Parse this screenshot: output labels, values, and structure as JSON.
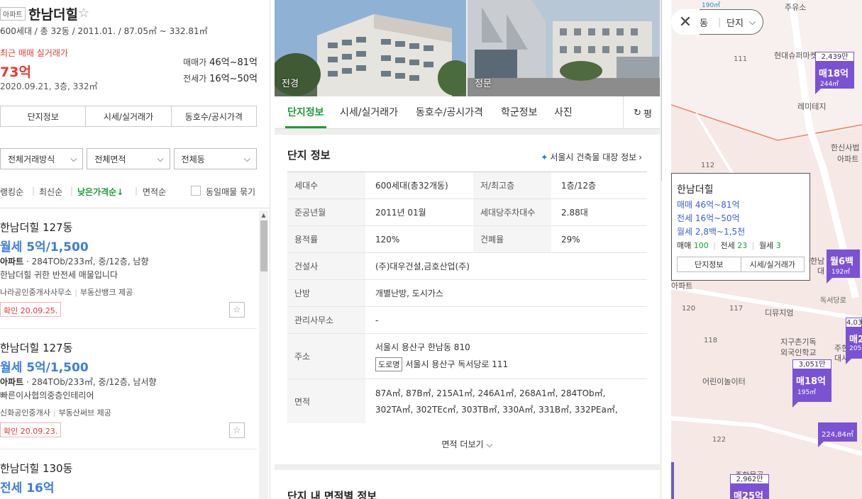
{
  "complex": {
    "type_badge": "아파트",
    "name": "한남더힐",
    "sub_info": "600세대 / 총 32동 / 2011.01. / 87.05㎡ ~ 332.81㎡",
    "recent_label": "최근 매매 실거래가",
    "recent_price": "73억",
    "recent_date": "2020.09.21, 3층, 332㎡",
    "sale_label": "매매가",
    "sale_range": "46억~81억",
    "jeonse_label": "전세가",
    "jeonse_range": "16억~50억"
  },
  "left_tabs": [
    "단지정보",
    "시세/실거래가",
    "동호수/공시가격"
  ],
  "filters": [
    "전체거래방식",
    "전체면적",
    "전체동"
  ],
  "sort": {
    "items": [
      "랭킹순",
      "최신순",
      "낮은가격순↓",
      "면적순"
    ],
    "active_index": 2,
    "group_label": "동일매물 묶기"
  },
  "listings": [
    {
      "title": "한남더힐 127동",
      "price": "월세 5억/1,500",
      "kind": "아파트",
      "detail": "284TOb/233㎡, 중/12층, 남향",
      "desc": "한남더힐 귀한 반전세 매물입니다",
      "agent": "나라공인중개사사무소",
      "provider": "부동산뱅크 제공",
      "confirm": "확인 20.09.25."
    },
    {
      "title": "한남더힐 127동",
      "price": "월세 5억/1,500",
      "kind": "아파트",
      "detail": "284TOb/233㎡, 중/12층, 남서향",
      "desc": "빠른이사협의중층인테리어",
      "agent": "신화공인중개사",
      "provider": "부동산써브 제공",
      "confirm": "확인 20.09.23."
    },
    {
      "title": "한남더힐 130동",
      "price": "전세 16억",
      "kind": "아파트",
      "detail": "",
      "desc": "",
      "agent": "",
      "provider": "",
      "confirm": ""
    }
  ],
  "photos": [
    {
      "label": "전경"
    },
    {
      "label": "정문"
    }
  ],
  "main_tabs": [
    "단지정보",
    "시세/실거래가",
    "동호수/공시가격",
    "학군정보",
    "사진"
  ],
  "pyeong_label": "평",
  "info": {
    "title": "단지 정보",
    "link": "서울시 건축물 대장 정보",
    "rows": [
      {
        "k": "세대수",
        "v": "600세대(총32개동)",
        "k2": "저/최고층",
        "v2": "1층/12층"
      },
      {
        "k": "준공년월",
        "v": "2011년 01월",
        "k2": "세대당주차대수",
        "v2": "2.88대"
      },
      {
        "k": "용적률",
        "v": "120%",
        "k2": "건폐율",
        "v2": "29%"
      },
      {
        "k": "건설사",
        "v": "(주)대우건설,금호산업(주)"
      },
      {
        "k": "난방",
        "v": "개별난방, 도시가스"
      },
      {
        "k": "관리사무소",
        "v": "-"
      }
    ],
    "address_label": "주소",
    "address": "서울시 용산구 한남동 810",
    "road_tag": "도로명",
    "road_address": "서울시 용산구 독서당로 111",
    "area_label": "면적",
    "area_line1": "87A㎡, 87B㎡, 215A1㎡, 246A1㎡, 268A1㎡, 284TOb㎡,",
    "area_line2": "302TA㎡, 302TEc㎡, 303TB㎡, 330A㎡, 331B㎡, 332PEa㎡,",
    "more": "면적 더보기"
  },
  "section2_title": "단지 내 면적별 정보",
  "map": {
    "pill_label": "단지",
    "pill_partial": "동",
    "labels": {
      "convenience": "주유소",
      "mart": "현대슈퍼마켓",
      "remitaj": "레미테지",
      "hannam_sabeop": "한신사법",
      "apt": "아파트",
      "dongseo": "독서당로",
      "digi": "디뮤지엄",
      "intl_school": "지구촌기독",
      "intl_school2": "외국인학교",
      "kids": "어린이놀이터",
      "juhan": "주한몽골",
      "juhan2": "대",
      "juhan3": "주한",
      "juhan4": "대사",
      "hannam": "한남",
      "hannam2": "대",
      "apt_small": "아파트",
      "p1": "112",
      "p2": "117",
      "p3": "122",
      "p4": "120",
      "p5": "111",
      "p6": "118"
    },
    "popup": {
      "name": "한남더힐",
      "sale": "매매 46억~81억",
      "jeonse": "전세 16억~50억",
      "rent": "월세 2,8백~1,5천",
      "count_sale_label": "매매",
      "count_sale": "100",
      "count_jeonse_label": "전세",
      "count_jeonse": "23",
      "count_rent_label": "월세",
      "count_rent": "3",
      "btn1": "단지정보",
      "btn2": "시세/실거래가"
    },
    "markers": [
      {
        "top": "2,439만",
        "big": "매18억",
        "small": "244㎡"
      },
      {
        "top": "",
        "big": "월6백",
        "small": "192㎡"
      },
      {
        "top": "3,051만",
        "big": "매18억",
        "small": "195㎡"
      },
      {
        "top": "4,03",
        "big": "매2",
        "small": "205"
      },
      {
        "top": "",
        "big": "",
        "small": "224,84㎡"
      },
      {
        "top": "2,962만",
        "big": "매25억",
        "small": ""
      }
    ],
    "top_label": "190㎡"
  },
  "colors": {
    "accent_green": "#1e9a3a",
    "price_blue": "#3b7ddd",
    "recent_red": "#e53935",
    "marker_purple": "#7b52d3"
  }
}
